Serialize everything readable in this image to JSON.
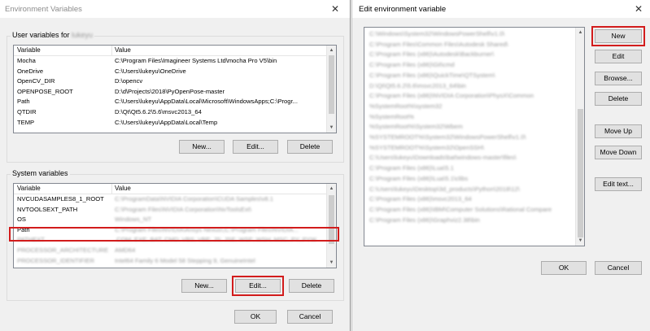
{
  "env_dialog": {
    "title": "Environment Variables",
    "close": "✕",
    "user_group_label": "User variables for",
    "user_name": "lukeyu",
    "columns": {
      "variable": "Variable",
      "value": "Value"
    },
    "user_vars": [
      {
        "name": "Mocha",
        "value": "C:\\Program Files\\Imagineer Systems Ltd\\mocha Pro V5\\bin"
      },
      {
        "name": "OneDrive",
        "value": "C:\\Users\\lukeyu\\OneDrive"
      },
      {
        "name": "OpenCV_DIR",
        "value": "D:\\opencv"
      },
      {
        "name": "OPENPOSE_ROOT",
        "value": "D:\\d\\Projects\\2018\\PyOpenPose-master"
      },
      {
        "name": "Path",
        "value": "C:\\Users\\lukeyu\\AppData\\Local\\Microsoft\\WindowsApps;C:\\Progr..."
      },
      {
        "name": "QTDIR",
        "value": "D:\\Qt\\Qt5.6.2\\5.6\\msvc2013_64"
      },
      {
        "name": "TEMP",
        "value": "C:\\Users\\lukeyu\\AppData\\Local\\Temp"
      }
    ],
    "user_buttons": {
      "new": "New...",
      "edit": "Edit...",
      "delete": "Delete"
    },
    "system_group_label": "System variables",
    "system_vars": [
      {
        "name": "NVCUDASAMPLES8_1_ROOT",
        "value": "C:\\ProgramData\\NVIDIA Corporation\\CUDA Samples\\v8.1"
      },
      {
        "name": "NVTOOLSEXT_PATH",
        "value": "C:\\Program Files\\NVIDIA Corporation\\NvToolsExt\\"
      },
      {
        "name": "OS",
        "value": "Windows_NT"
      },
      {
        "name": "Path",
        "value": "C:\\Program Files\\NVIDIA\\Ansys Nexus\\;C:\\Program Files\\NVIDIA..."
      },
      {
        "name": "PATHEXT",
        "value": ".COM;.EXE;.BAT;.CMD;.VBS;.VBE;.JS;.JSE;.WSF;.WSH;.MSC;.PY;.PYW"
      },
      {
        "name": "PROCESSOR_ARCHITECTURE",
        "value": "AMD64"
      },
      {
        "name": "PROCESSOR_IDENTIFIER",
        "value": "Intel64 Family 6 Model 58 Stepping 9, GenuineIntel"
      }
    ],
    "system_buttons": {
      "new": "New...",
      "edit": "Edit...",
      "delete": "Delete"
    },
    "ok": "OK",
    "cancel": "Cancel"
  },
  "edit_dialog": {
    "title": "Edit environment variable",
    "close": "✕",
    "entries": [
      "C:\\Windows\\System32\\WindowsPowerShell\\v1.0\\",
      "C:\\Program Files\\Common Files\\Autodesk Shared\\",
      "C:\\Program Files (x86)\\Autodesk\\Backburner\\",
      "C:\\Program Files (x86)\\Git\\cmd",
      "C:\\Program Files (x86)\\QuickTime\\QTSystem\\",
      "D:\\Qt\\Qt5.6.2\\5.6\\msvc2013_64\\bin",
      "C:\\Program Files (x86)\\NVIDIA Corporation\\PhysX\\Common",
      "%SystemRoot%\\system32",
      "%SystemRoot%",
      "%SystemRoot%\\System32\\Wbem",
      "%SYSTEMROOT%\\System32\\WindowsPowerShell\\v1.0\\",
      "%SYSTEMROOT%\\System32\\OpenSSH\\",
      "C:\\Users\\lukeyu\\Downloads\\bat\\windows-master\\files\\",
      "C:\\Program Files (x86)\\Lua\\5.1",
      "C:\\Program Files (x86)\\Lua\\5.1\\clibs",
      "C:\\Users\\lukeyu\\Desktop\\3d_products\\Python\\2018\\12\\",
      "C:\\Program Files (x86)\\msvc2013_64",
      "C:\\Program Files (x86)\\IBM\\Computer Solutions\\Rational Compare",
      "C:\\Program Files (x86)\\Graphviz2.38\\bin"
    ],
    "buttons": {
      "new": "New",
      "edit": "Edit",
      "browse": "Browse...",
      "delete": "Delete",
      "move_up": "Move Up",
      "move_down": "Move Down",
      "edit_text": "Edit text..."
    },
    "ok": "OK",
    "cancel": "Cancel"
  },
  "colors": {
    "highlight": "#d21c1c",
    "dialog_bg": "#f0f0f0",
    "button_bg": "#e1e1e1"
  }
}
